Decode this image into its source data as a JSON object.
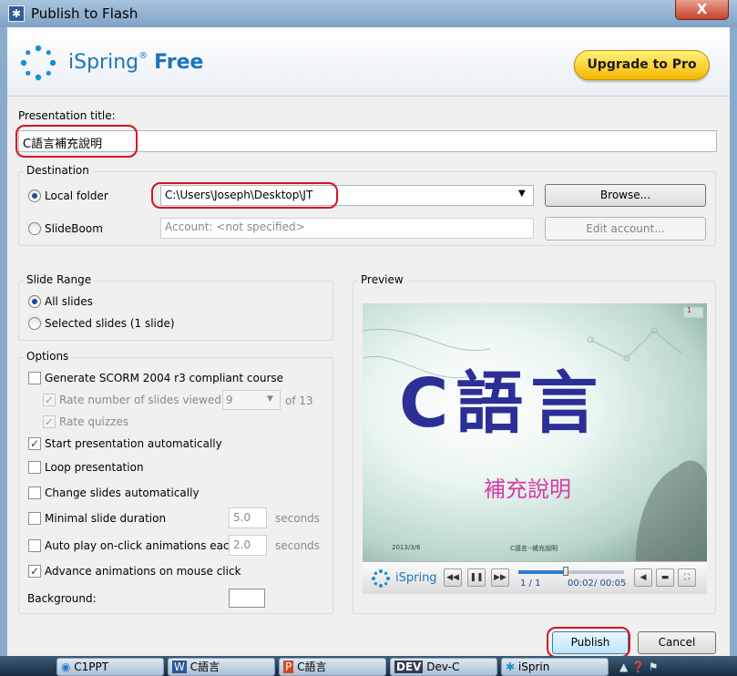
{
  "window": {
    "title": "Publish to Flash",
    "close_glyph": "X"
  },
  "header": {
    "brand": "iSpring",
    "edition": "Free",
    "reg_mark": "®",
    "upgrade_label": "Upgrade to Pro"
  },
  "presentation": {
    "title_label": "Presentation title:",
    "title_value": "C語言補充說明"
  },
  "destination": {
    "group_label": "Destination",
    "local_label": "Local folder",
    "local_selected": true,
    "folder_path": "C:\\Users\\Joseph\\Desktop\\JT",
    "browse_label": "Browse...",
    "slideboom_label": "SlideBoom",
    "account_placeholder": "Account: <not specified>",
    "edit_account_label": "Edit account..."
  },
  "slide_range": {
    "group_label": "Slide Range",
    "all_label": "All slides",
    "selected_label": "Selected slides (1 slide)"
  },
  "options": {
    "group_label": "Options",
    "scorm_label": "Generate SCORM 2004 r3 compliant course",
    "rate_viewed_label": "Rate number of slides viewed:",
    "rate_viewed_value": "9",
    "rate_viewed_of": "of 13",
    "rate_quizzes_label": "Rate quizzes",
    "start_auto_label": "Start presentation automatically",
    "loop_label": "Loop presentation",
    "change_auto_label": "Change slides automatically",
    "min_duration_label": "Minimal slide duration",
    "min_duration_value": "5.0",
    "autoplay_label": "Auto play on-click animations each",
    "autoplay_value": "2.0",
    "seconds_label": "seconds",
    "advance_label": "Advance animations on mouse click",
    "background_label": "Background:"
  },
  "preview": {
    "group_label": "Preview",
    "slide_title": "C語言",
    "slide_subtitle": "補充說明",
    "slide_date": "2013/3/6",
    "slide_footer": "C語言--補充說明",
    "slide_page_marker": "1",
    "player_brand": "iSpring",
    "slide_counter": "1 / 1",
    "time_elapsed": "00:02",
    "time_total": "/ 00:05",
    "time_progress": 0.45
  },
  "footer": {
    "publish_label": "Publish",
    "cancel_label": "Cancel"
  },
  "taskbar": {
    "items": [
      "C1PPT",
      "C語言",
      "C語言",
      "Dev-C",
      "iSprin"
    ],
    "dev_badge": "DEV"
  },
  "colors": {
    "accent": "#1a75bb",
    "highlight_ring": "#d8101d",
    "title_text": "#2c2f96",
    "subtitle_text": "#d63aa9"
  }
}
